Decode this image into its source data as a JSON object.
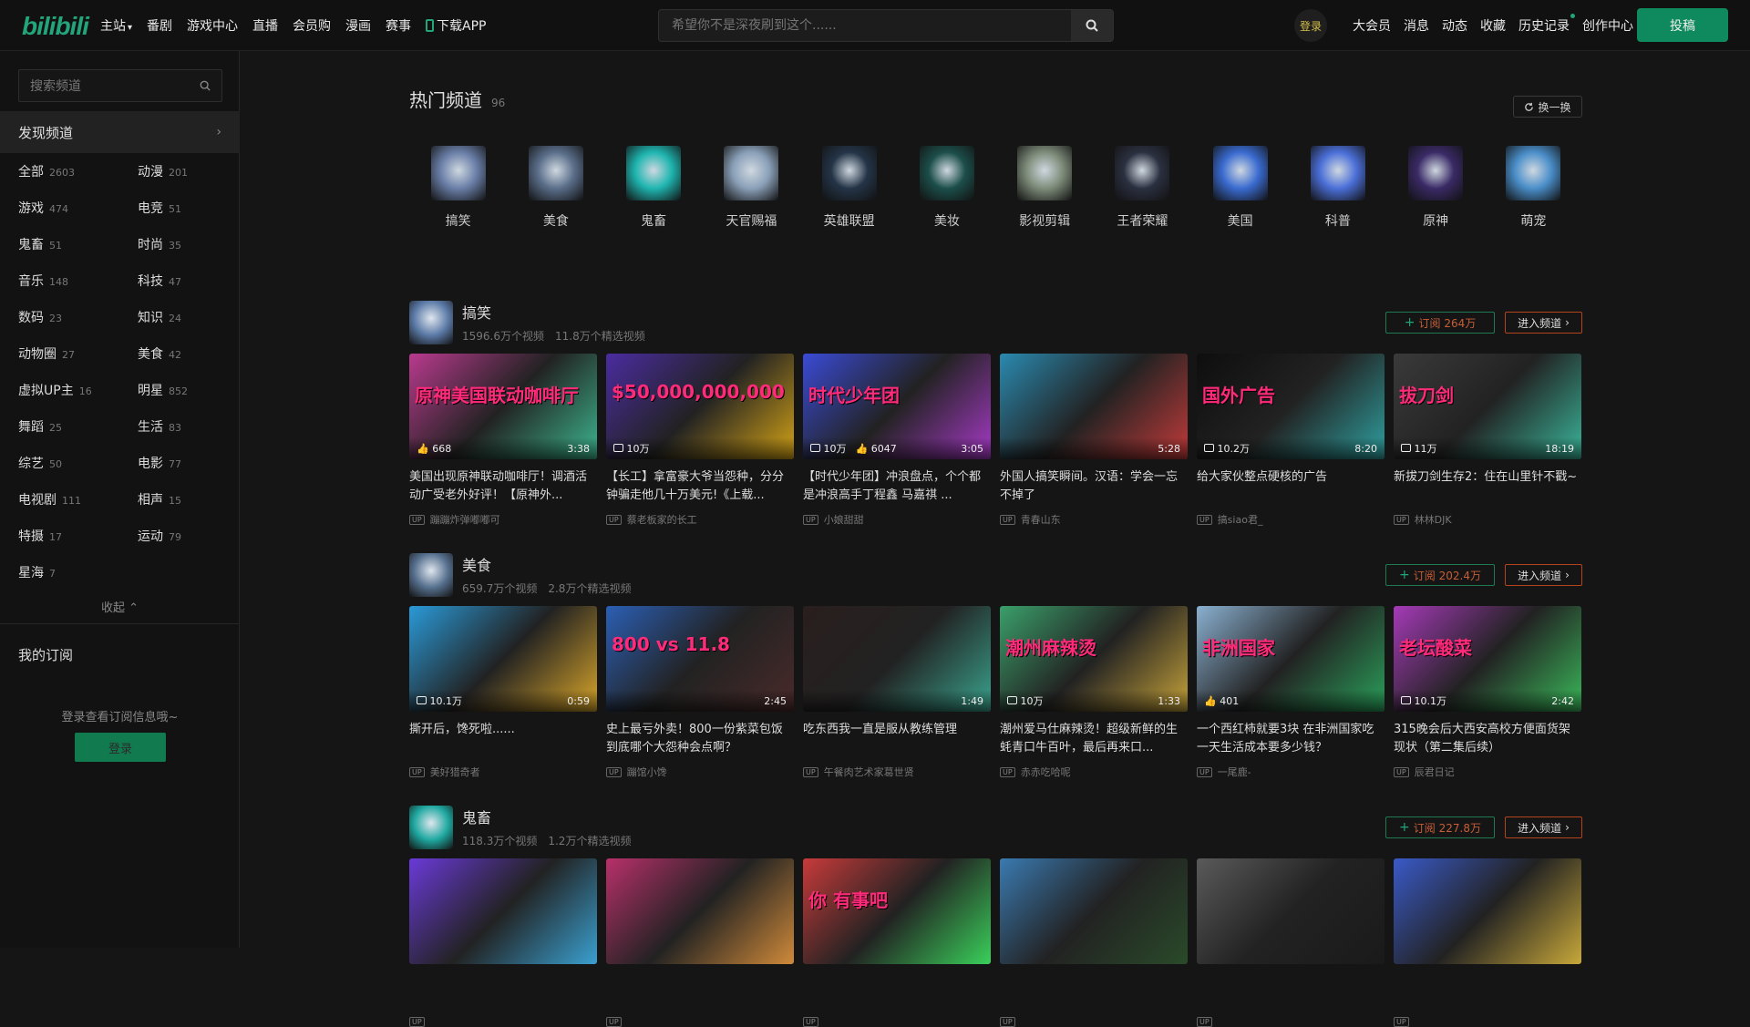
{
  "header": {
    "logo": "bilibili",
    "nav": [
      "主站",
      "番剧",
      "游戏中心",
      "直播",
      "会员购",
      "漫画",
      "赛事",
      "下载APP"
    ],
    "search_placeholder": "希望你不是深夜刷到这个......",
    "avatar_label": "登录",
    "right_nav": [
      "大会员",
      "消息",
      "动态",
      "收藏",
      "历史记录",
      "创作中心"
    ],
    "upload_label": "投稿"
  },
  "sidebar": {
    "search_placeholder": "搜索频道",
    "discover_label": "发现频道",
    "categories": [
      {
        "name": "全部",
        "count": "2603"
      },
      {
        "name": "动漫",
        "count": "201"
      },
      {
        "name": "游戏",
        "count": "474"
      },
      {
        "name": "电竞",
        "count": "51"
      },
      {
        "name": "鬼畜",
        "count": "51"
      },
      {
        "name": "时尚",
        "count": "35"
      },
      {
        "name": "音乐",
        "count": "148"
      },
      {
        "name": "科技",
        "count": "47"
      },
      {
        "name": "数码",
        "count": "23"
      },
      {
        "name": "知识",
        "count": "24"
      },
      {
        "name": "动物圈",
        "count": "27"
      },
      {
        "name": "美食",
        "count": "42"
      },
      {
        "name": "虚拟UP主",
        "count": "16"
      },
      {
        "name": "明星",
        "count": "852"
      },
      {
        "name": "舞蹈",
        "count": "25"
      },
      {
        "name": "生活",
        "count": "83"
      },
      {
        "name": "综艺",
        "count": "50"
      },
      {
        "name": "电影",
        "count": "77"
      },
      {
        "name": "电视剧",
        "count": "111"
      },
      {
        "name": "相声",
        "count": "15"
      },
      {
        "name": "特摄",
        "count": "17"
      },
      {
        "name": "运动",
        "count": "79"
      },
      {
        "name": "星海",
        "count": "7"
      }
    ],
    "collapse_label": "收起",
    "my_sub_label": "我的订阅",
    "login_hint": "登录查看订阅信息哦~",
    "login_button": "登录"
  },
  "hot": {
    "title": "热门频道",
    "count": "96",
    "swap_label": "换一换",
    "channels": [
      {
        "name": "搞笑",
        "color": "#6a7fa8"
      },
      {
        "name": "美食",
        "color": "#5a6e8a"
      },
      {
        "name": "鬼畜",
        "color": "#1fb5b0"
      },
      {
        "name": "天官赐福",
        "color": "#8aa0b8"
      },
      {
        "name": "英雄联盟",
        "color": "#243447"
      },
      {
        "name": "美妆",
        "color": "#1c4e4a"
      },
      {
        "name": "影视剪辑",
        "color": "#7e8c7a"
      },
      {
        "name": "王者荣耀",
        "color": "#2b3040"
      },
      {
        "name": "美国",
        "color": "#3a6bd0"
      },
      {
        "name": "科普",
        "color": "#4b6fd8"
      },
      {
        "name": "原神",
        "color": "#3a2a66"
      },
      {
        "name": "萌宠",
        "color": "#4a8ec9"
      }
    ]
  },
  "sections": [
    {
      "name": "搞笑",
      "videos_stat": "1596.6万个视频",
      "selected_stat": "11.8万个精选视频",
      "subscribe": "订阅 264万",
      "enter": "进入频道",
      "avatar_color": "#5c7ba8",
      "cards": [
        {
          "title": "美国出现原神联动咖啡厅！调酒活动广受老外好评！【原神外...",
          "up": "蹦蹦炸弹嘟嘟可",
          "plays": "",
          "likes": "668",
          "duration": "3:38",
          "colors": [
            "#b93a8e",
            "#3db58e"
          ],
          "text": "原神美国联动咖啡厅"
        },
        {
          "title": "【长工】拿富豪大爷当怨种，分分钟骗走他几十万美元!《上载...",
          "up": "蔡老板家的长工",
          "plays": "10万",
          "likes": "",
          "duration": "",
          "colors": [
            "#4a2ca0",
            "#d4a317"
          ],
          "text": "$50,000,000,000"
        },
        {
          "title": "【时代少年团】冲浪盘点，个个都是冲浪高手丁程鑫 马嘉祺 ...",
          "up": "小娘甜甜",
          "plays": "10万",
          "likes": "6047",
          "duration": "3:05",
          "colors": [
            "#3a4bd6",
            "#a63ac6"
          ],
          "text": "时代少年团"
        },
        {
          "title": "外国人搞笑瞬间。汉语：学会一忘不掉了",
          "up": "青春山东",
          "plays": "",
          "likes": "",
          "duration": "5:28",
          "colors": [
            "#2a8ab0",
            "#c23a3a"
          ],
          "text": ""
        },
        {
          "title": "给大家伙整点硬核的广告",
          "up": "搞siao君_",
          "plays": "10.2万",
          "likes": "",
          "duration": "8:20",
          "colors": [
            "#0e0e0e",
            "#2fa0a0"
          ],
          "text": "国外广告"
        },
        {
          "title": "新拔刀剑生存2：住在山里针不戳~",
          "up": "林林DJK",
          "plays": "11万",
          "likes": "",
          "duration": "18:19",
          "colors": [
            "#3a3a3a",
            "#3ab59a"
          ],
          "text": "拔刀剑"
        }
      ]
    },
    {
      "name": "美食",
      "videos_stat": "659.7万个视频",
      "selected_stat": "2.8万个精选视频",
      "subscribe": "订阅 202.4万",
      "enter": "进入频道",
      "avatar_color": "#56708e",
      "cards": [
        {
          "title": "撕开后，馋死啦......",
          "up": "美好猎奇者",
          "plays": "10.1万",
          "likes": "",
          "duration": "0:59",
          "colors": [
            "#2a9ad8",
            "#d8a52a"
          ],
          "text": ""
        },
        {
          "title": "史上最亏外卖！800一份紫菜包饭到底哪个大怨种会点啊？",
          "up": "蹦馆小馋",
          "plays": "",
          "likes": "",
          "duration": "2:45",
          "colors": [
            "#2b5fb5",
            "#4a2a2a"
          ],
          "text": "800 vs 11.8"
        },
        {
          "title": "吃东西我一直是服从教练管理",
          "up": "午餐肉艺术家葛世贤",
          "plays": "",
          "likes": "",
          "duration": "1:49",
          "colors": [
            "#2a1e1e",
            "#3aa38e"
          ],
          "text": ""
        },
        {
          "title": "潮州爱马仕麻辣烫！超级新鲜的生蚝青口牛百叶，最后再来口...",
          "up": "赤赤吃哈呢",
          "plays": "10万",
          "likes": "",
          "duration": "1:33",
          "colors": [
            "#3a9f6a",
            "#c5a23a"
          ],
          "text": "潮州麻辣烫"
        },
        {
          "title": "一个西红柿就要3块 在非洲国家吃一天生活成本要多少钱？",
          "up": "一尾鹿-",
          "plays": "",
          "likes": "401",
          "duration": "",
          "colors": [
            "#8ab0d0",
            "#2aa05a"
          ],
          "text": "非洲国家"
        },
        {
          "title": "315晚会后大西安高校方便面货架现状（第二集后续）",
          "up": "辰君日记",
          "plays": "10.1万",
          "likes": "",
          "duration": "2:42",
          "colors": [
            "#a53ab8",
            "#3ab85a"
          ],
          "text": "老坛酸菜"
        }
      ]
    },
    {
      "name": "鬼畜",
      "videos_stat": "118.3万个视频",
      "selected_stat": "1.2万个精选视频",
      "subscribe": "订阅 227.8万",
      "enter": "进入频道",
      "avatar_color": "#1fa8a0",
      "cards": [
        {
          "title": "",
          "up": "",
          "plays": "",
          "likes": "",
          "duration": "",
          "colors": [
            "#6a3ad8",
            "#3aa0d0"
          ],
          "text": ""
        },
        {
          "title": "",
          "up": "",
          "plays": "",
          "likes": "",
          "duration": "",
          "colors": [
            "#b8306a",
            "#d08a3a"
          ],
          "text": ""
        },
        {
          "title": "",
          "up": "",
          "plays": "",
          "likes": "",
          "duration": "",
          "colors": [
            "#c83a3a",
            "#3ad05a"
          ],
          "text": "你 有事吧"
        },
        {
          "title": "",
          "up": "",
          "plays": "",
          "likes": "",
          "duration": "",
          "colors": [
            "#3a7ab0",
            "#2a4a2a"
          ],
          "text": ""
        },
        {
          "title": "",
          "up": "",
          "plays": "",
          "likes": "",
          "duration": "",
          "colors": [
            "#5a5a5a",
            "#1a1a1a"
          ],
          "text": ""
        },
        {
          "title": "",
          "up": "",
          "plays": "",
          "likes": "",
          "duration": "",
          "colors": [
            "#3a5ac8",
            "#c8a83a"
          ],
          "text": ""
        }
      ]
    }
  ]
}
